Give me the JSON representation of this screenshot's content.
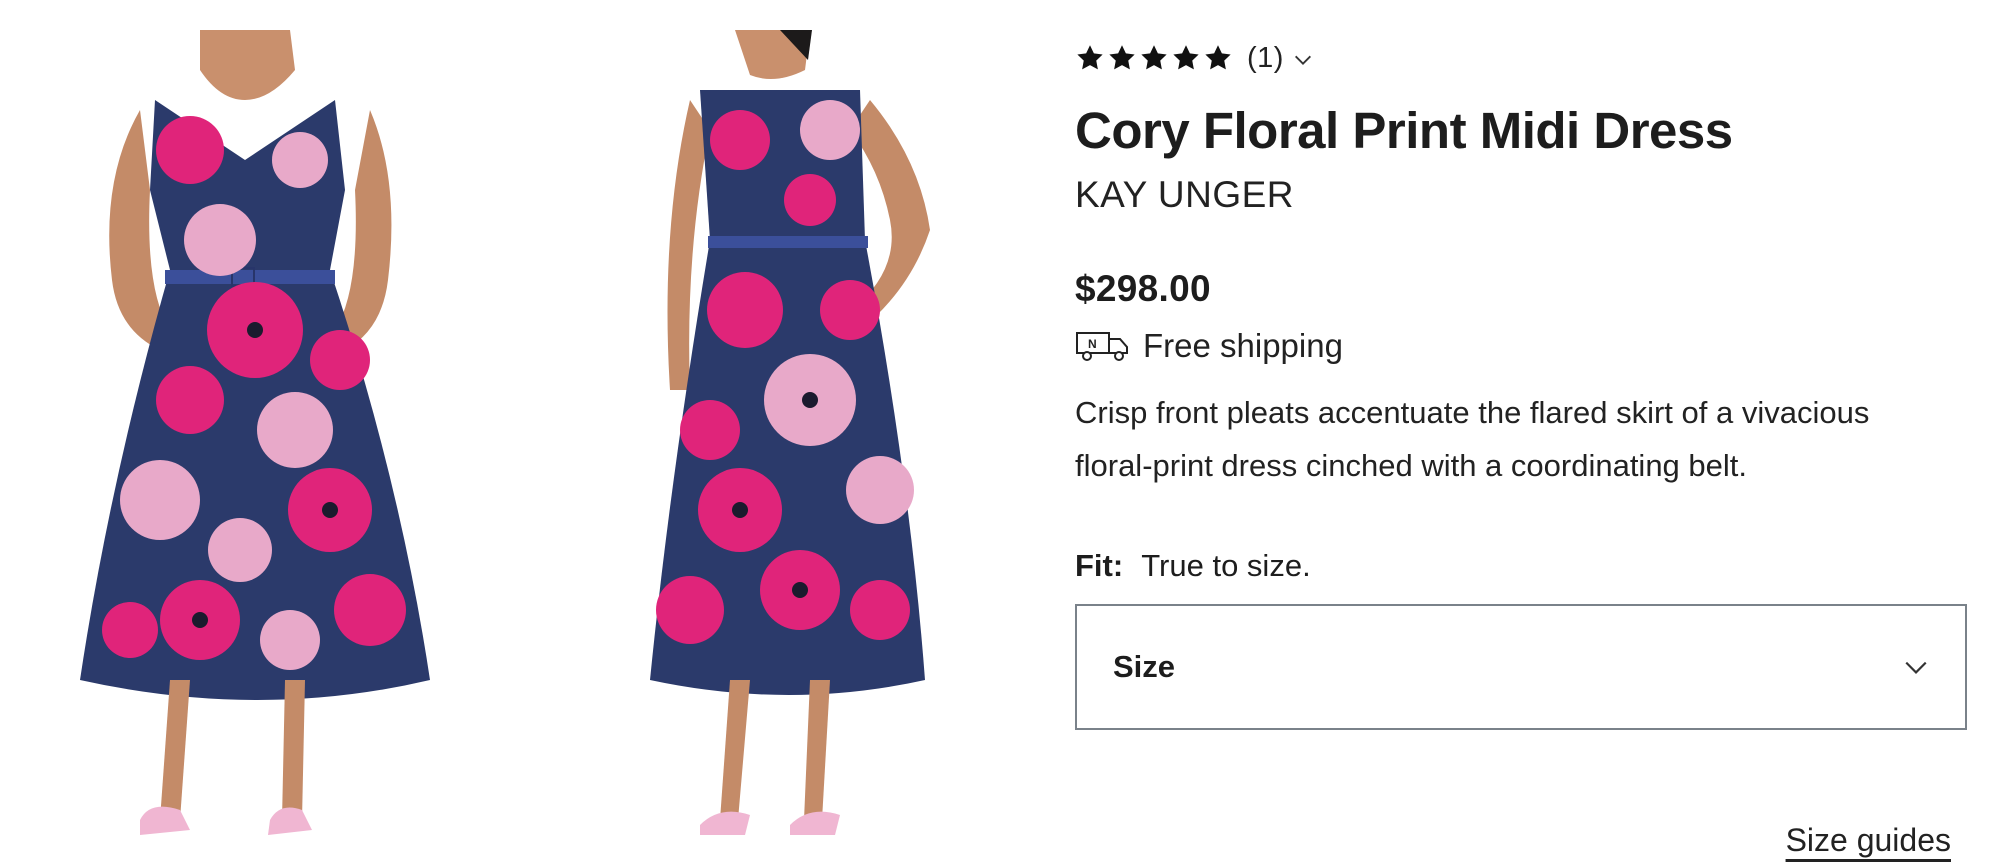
{
  "gallery": {
    "images": [
      {
        "name": "front-view",
        "alt": "Model wearing floral dress, front view"
      },
      {
        "name": "back-view",
        "alt": "Model wearing floral dress, back view"
      }
    ]
  },
  "product": {
    "rating": 5,
    "review_count": "(1)",
    "title": "Cory Floral Print Midi Dress",
    "brand": "KAY UNGER",
    "price": "$298.00",
    "shipping_text": "Free shipping",
    "description": "Crisp front pleats accentuate the flared skirt of a vivacious floral-print dress cinched with a coordinating belt.",
    "fit_label": "Fit:",
    "fit_value": "True to size.",
    "size_select_label": "Size",
    "size_guides_link": "Size guides"
  },
  "icons": {
    "star": "star-icon",
    "chevron": "chevron-down-icon",
    "truck": "truck-icon"
  },
  "colors": {
    "dress_navy": "#2b3a6b",
    "dress_pink": "#e0247a",
    "dress_light_pink": "#e8a9c9",
    "border_gray": "#7a828a",
    "text": "#1d1d1d"
  }
}
